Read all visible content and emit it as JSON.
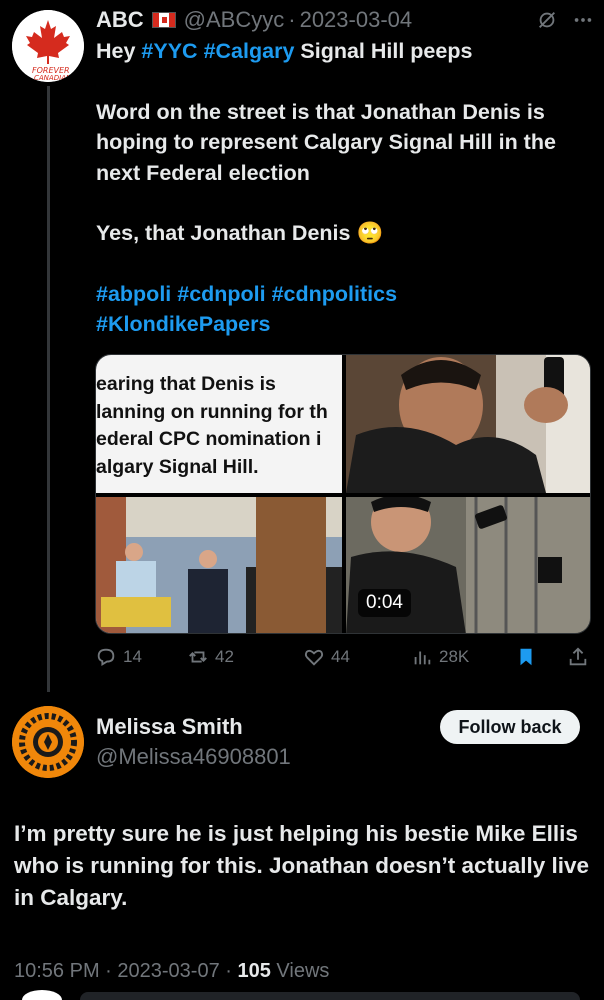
{
  "tweet": {
    "author_name": "ABC",
    "flag_icon": "canada-flag-icon",
    "handle": "@ABCyyc",
    "dot": "·",
    "date": "2023-03-04",
    "avatar_text_top": "FOREVER",
    "avatar_text_bottom": "CANADIAN",
    "line1_prefix": "Hey ",
    "line1_tag1": "#YYC",
    "line1_tag2": "#Calgary",
    "line1_suffix": " Signal Hill peeps",
    "para2": "Word on the street is that Jonathan Denis is hoping to represent Calgary Signal Hill in the next Federal election",
    "para3": "Yes, that Jonathan Denis 🙄",
    "hashtags_line1": "#abpoli #cdnpoli #cdnpolitics",
    "hashtags_line2": "#KlondikePapers",
    "media_text": [
      "earing that Denis is",
      "lanning on running for th",
      "ederal CPC nomination i",
      "algary Signal Hill."
    ],
    "video_time": "0:04",
    "actions": {
      "replies": "14",
      "reposts": "42",
      "likes": "44",
      "views": "28K"
    }
  },
  "reply": {
    "name": "Melissa Smith",
    "handle": "@Melissa46908801",
    "follow_label": "Follow back",
    "avatar_text": "EVERY CHILD MATTERS",
    "body": "I’m pretty sure he is just helping his bestie Mike Ellis who is running for this. Jonathan doesn’t actually live in Calgary.",
    "time": "10:56 PM",
    "date": "2023-03-07",
    "views_count": "105",
    "views_label": "Views"
  },
  "colors": {
    "accent": "#1d9bf0",
    "muted": "#71767b",
    "text": "#e7e9ea",
    "bookmark": "#1d9bf0"
  }
}
